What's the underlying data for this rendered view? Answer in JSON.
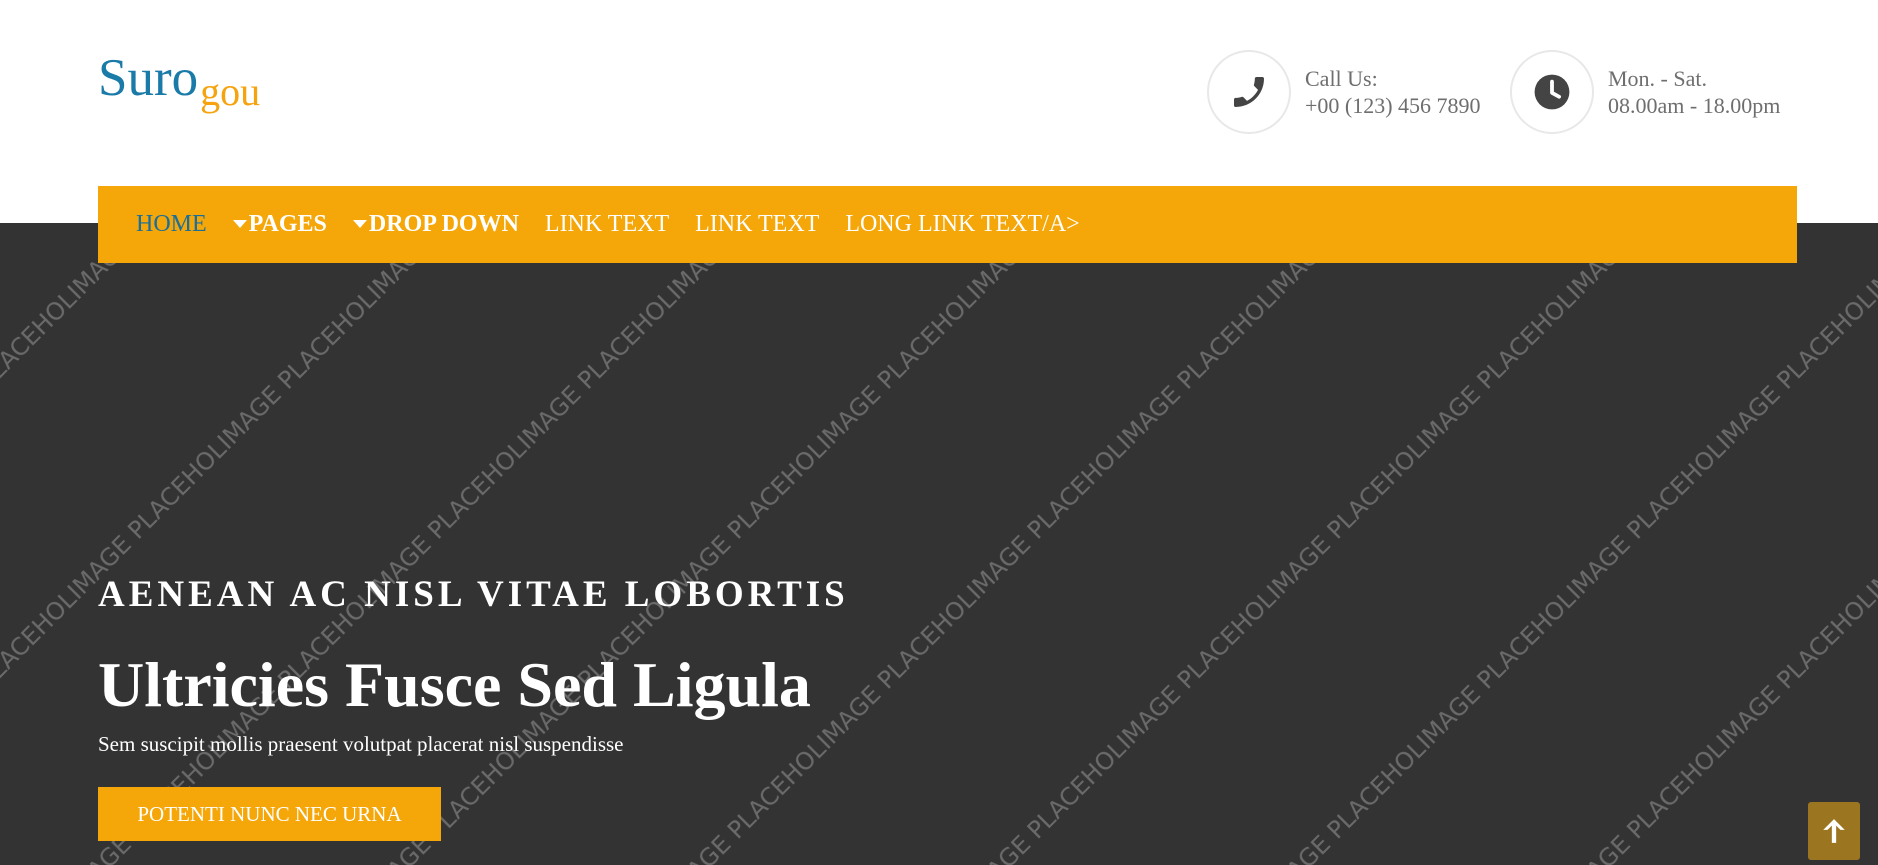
{
  "brand": {
    "main": "Suro",
    "sub": "gou"
  },
  "contact": {
    "phone": {
      "label": "Call Us:",
      "value": "+00 (123) 456 7890",
      "icon": "phone-icon"
    },
    "hours": {
      "label": "Mon. - Sat.",
      "value": "08.00am - 18.00pm",
      "icon": "clock-icon"
    }
  },
  "nav": {
    "items": [
      {
        "label": "HOME"
      },
      {
        "label": "PAGES"
      },
      {
        "label": "DROP DOWN"
      },
      {
        "label": "LINK TEXT"
      },
      {
        "label": "LINK TEXT"
      },
      {
        "label": "LONG LINK TEXT/A>"
      }
    ]
  },
  "hero": {
    "placeholder_text": "IMAGE PLACEHOLDER",
    "eyebrow": "AENEAN AC NISL VITAE LOBORTIS",
    "title": "Ultricies Fusce Sed Ligula",
    "subtitle": "Sem suscipit mollis praesent volutpat placerat nisl suspendisse",
    "cta": "POTENTI NUNC NEC URNA"
  },
  "colors": {
    "accent": "#f5a609",
    "brand_blue": "#1a7aa8",
    "hero_bg": "#333333",
    "scroll_top": "#9b7520"
  },
  "scroll_top": {
    "icon": "arrow-up-icon"
  }
}
